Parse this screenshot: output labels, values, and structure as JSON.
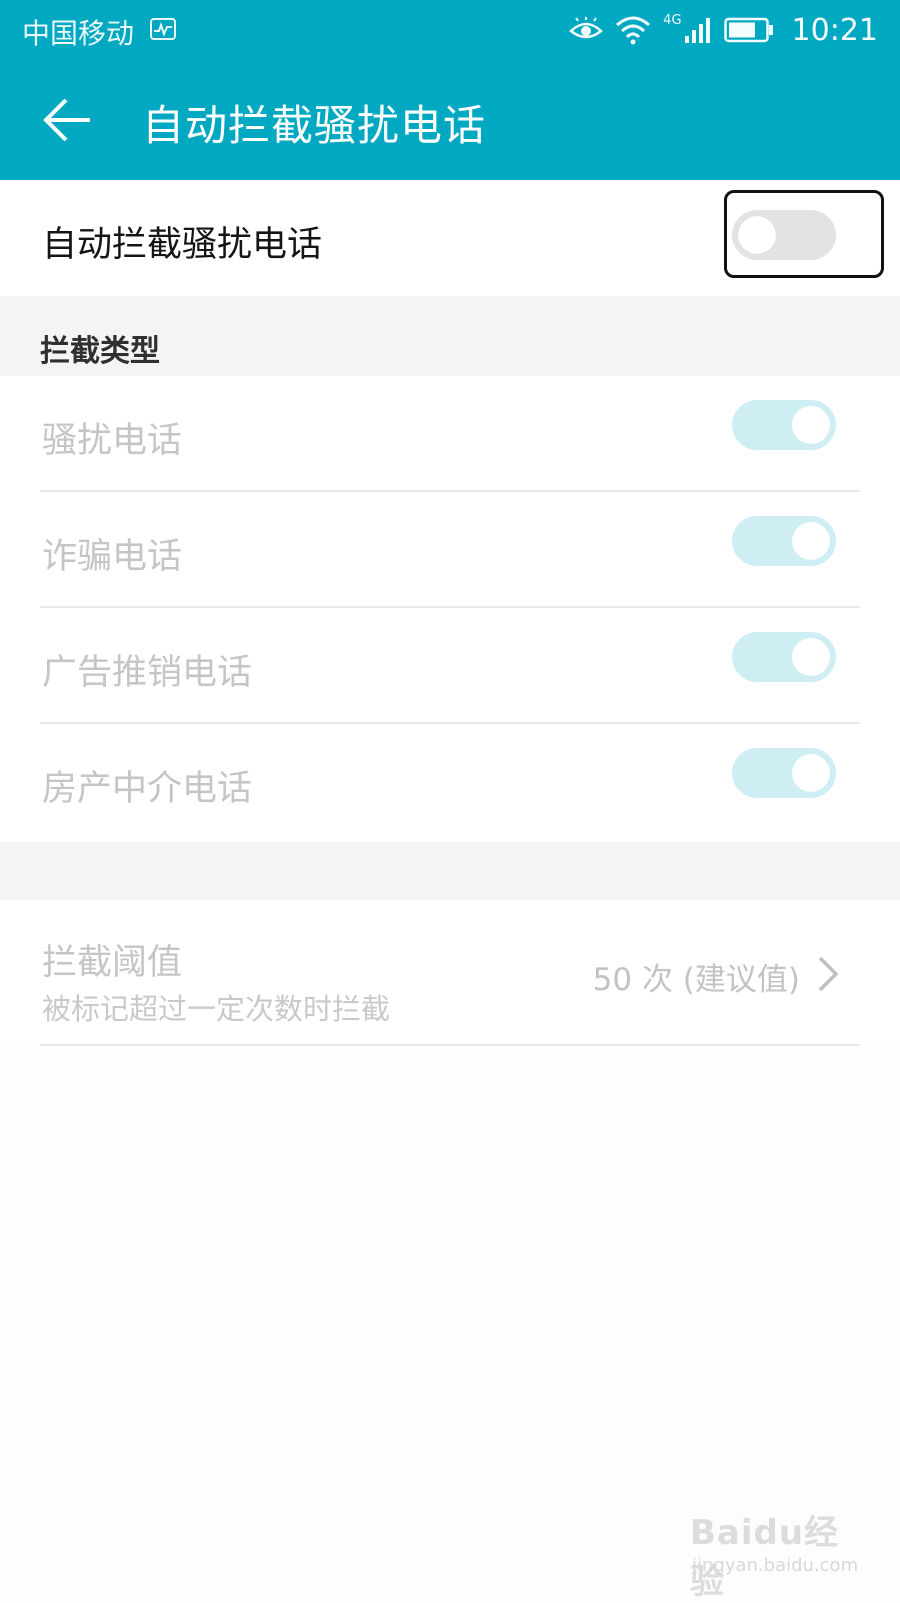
{
  "status_bar": {
    "carrier": "中国移动",
    "network": "4G",
    "time": "10:21"
  },
  "app_bar": {
    "title": "自动拦截骚扰电话"
  },
  "main_toggle": {
    "label": "自动拦截骚扰电话",
    "state": "off"
  },
  "intercept_types": {
    "header": "拦截类型",
    "items": [
      {
        "label": "骚扰电话",
        "state": "on"
      },
      {
        "label": "诈骗电话",
        "state": "on"
      },
      {
        "label": "广告推销电话",
        "state": "on"
      },
      {
        "label": "房产中介电话",
        "state": "on"
      }
    ]
  },
  "threshold": {
    "title": "拦截阈值",
    "subtitle": "被标记超过一定次数时拦截",
    "value": "50 次 (建议值)"
  },
  "watermark": {
    "main": "Baidu经验",
    "sub": "jingyan.baidu.com"
  },
  "colors": {
    "accent": "#01a8c1",
    "toggle_on_disabled": "#cfeef3",
    "toggle_off": "#e3e3e3"
  }
}
